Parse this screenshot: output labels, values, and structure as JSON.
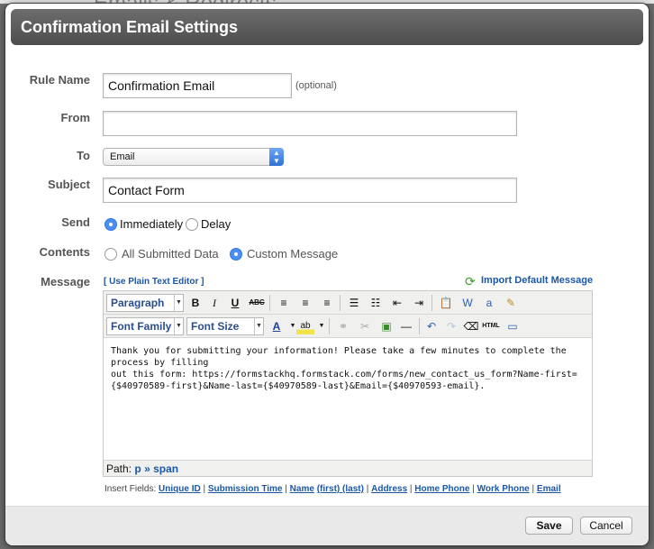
{
  "background": {
    "title": "Emails & Redirects"
  },
  "dialog": {
    "title": "Confirmation Email Settings"
  },
  "form": {
    "rule_name": {
      "label": "Rule Name",
      "value": "Confirmation Email",
      "hint": "(optional)"
    },
    "from": {
      "label": "From",
      "value": ""
    },
    "to": {
      "label": "To",
      "value": "Email"
    },
    "subject": {
      "label": "Subject",
      "value": "Contact Form"
    },
    "send": {
      "label": "Send",
      "options": [
        "Immediately",
        "Delay"
      ],
      "selected": "Immediately"
    },
    "contents": {
      "label": "Contents",
      "options": [
        "All Submitted Data",
        "Custom Message"
      ],
      "selected": "Custom Message"
    },
    "message": {
      "label": "Message"
    }
  },
  "editor": {
    "plain_text_link": "[ Use Plain Text Editor ]",
    "import_default": "Import Default Message",
    "paragraph_select": "Paragraph",
    "font_family_select": "Font Family",
    "font_size_select": "Font Size",
    "body_line1": "Thank you for submitting your information! Please take a few minutes to complete the process by filling",
    "body_line2": "out this form: https://formstackhq.formstack.com/forms/new_contact_us_form?Name-first=",
    "body_line3": "{$40970589-first}&Name-last={$40970589-last}&Email={$40970593-email}.",
    "path_label": "Path:",
    "path_p": "p",
    "path_sep": "»",
    "path_span": "span"
  },
  "insert_fields": {
    "label": "Insert Fields:",
    "items": [
      "Unique ID",
      "Submission Time",
      "Name",
      "(first) (last)",
      "Address",
      "Home Phone",
      "Work Phone",
      "Email"
    ]
  },
  "footer": {
    "save": "Save",
    "cancel": "Cancel"
  },
  "colors": {
    "link": "#1c57a6",
    "titlebar": "#5a5a5a",
    "radio_on": "#4a8ff0",
    "footer": "#e9e9e9"
  },
  "icons": [
    "bold-icon",
    "italic-icon",
    "underline-icon",
    "strikethrough-icon",
    "align-left-icon",
    "align-center-icon",
    "align-right-icon",
    "bullet-list-icon",
    "numbered-list-icon",
    "outdent-icon",
    "indent-icon",
    "paste-icon",
    "paste-word-icon",
    "paste-text-icon",
    "cleanup-icon",
    "font-color-icon",
    "highlight-icon",
    "link-icon",
    "unlink-icon",
    "image-icon",
    "horizontal-rule-icon",
    "undo-icon",
    "redo-icon",
    "remove-format-icon",
    "html-source-icon",
    "fullscreen-icon",
    "refresh-icon"
  ]
}
